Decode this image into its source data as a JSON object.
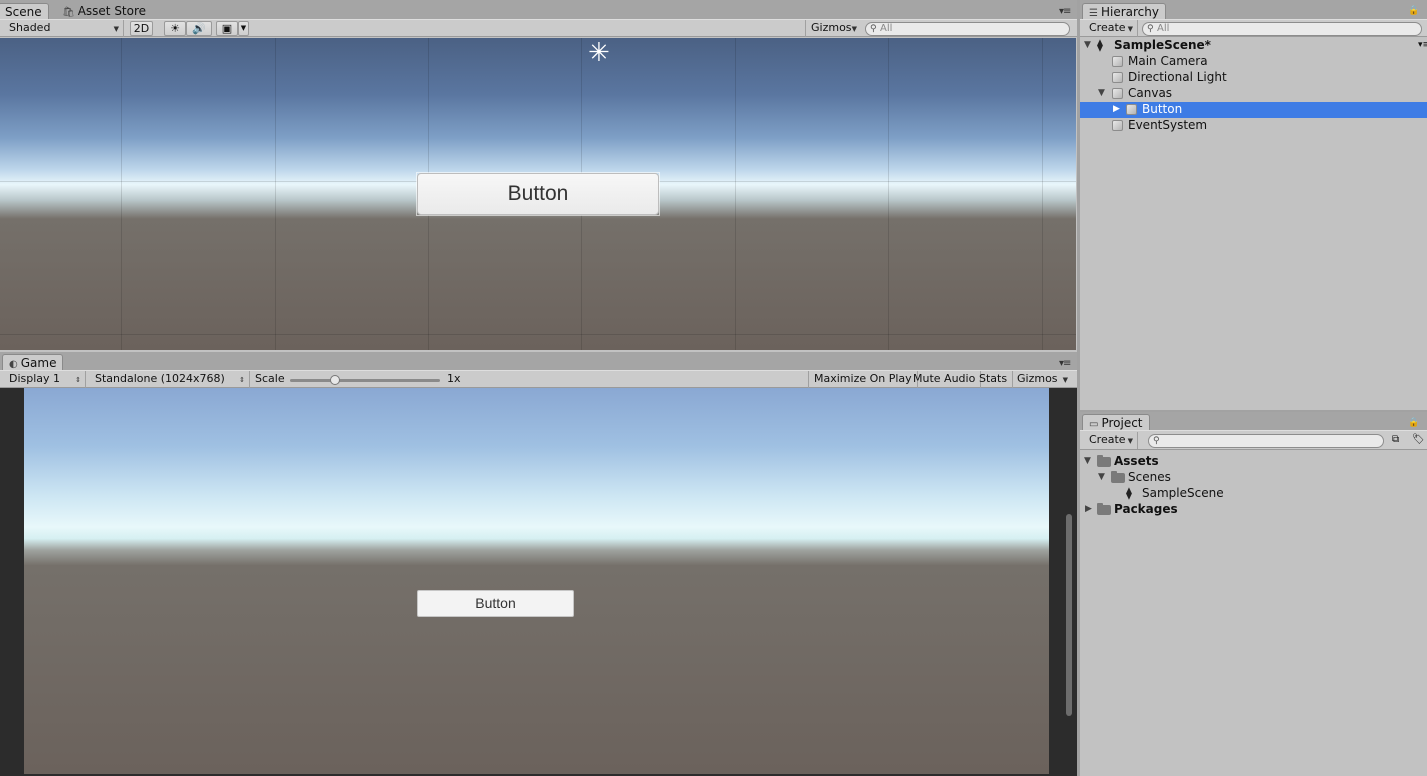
{
  "scene_panel": {
    "tabs": [
      {
        "label": "Scene",
        "active": true
      },
      {
        "label": "Asset Store",
        "active": false
      }
    ],
    "toolbar": {
      "shading_mode": "Shaded",
      "mode_2d": "2D",
      "gizmos_label": "Gizmos",
      "search_placeholder": "All"
    },
    "button_text": "Button"
  },
  "game_panel": {
    "tab": "Game",
    "toolbar": {
      "display": "Display 1",
      "resolution": "Standalone (1024x768)",
      "scale_label": "Scale",
      "scale_value": "1x",
      "scale_slider_position": 0.3,
      "maximize_label": "Maximize On Play",
      "mute_label": "Mute Audio",
      "stats_label": "Stats",
      "gizmos_label": "Gizmos"
    },
    "button_text": "Button"
  },
  "hierarchy": {
    "tab": "Hierarchy",
    "create_label": "Create",
    "search_placeholder": "All",
    "scene_name": "SampleScene*",
    "items": [
      {
        "label": "Main Camera",
        "selected": false
      },
      {
        "label": "Directional Light",
        "selected": false
      },
      {
        "label": "Canvas",
        "selected": false
      },
      {
        "label": "Button",
        "selected": true
      },
      {
        "label": "EventSystem",
        "selected": false
      }
    ]
  },
  "project": {
    "tab": "Project",
    "create_label": "Create",
    "tree": [
      {
        "label": "Assets",
        "bold": true
      },
      {
        "label": "Scenes",
        "bold": false
      },
      {
        "label": "SampleScene",
        "bold": false
      },
      {
        "label": "Packages",
        "bold": true
      }
    ]
  },
  "colors": {
    "selection": "#3e7ce5",
    "panel_bg": "#c2c2c2",
    "toolbar_bg": "#cbcbcb"
  }
}
